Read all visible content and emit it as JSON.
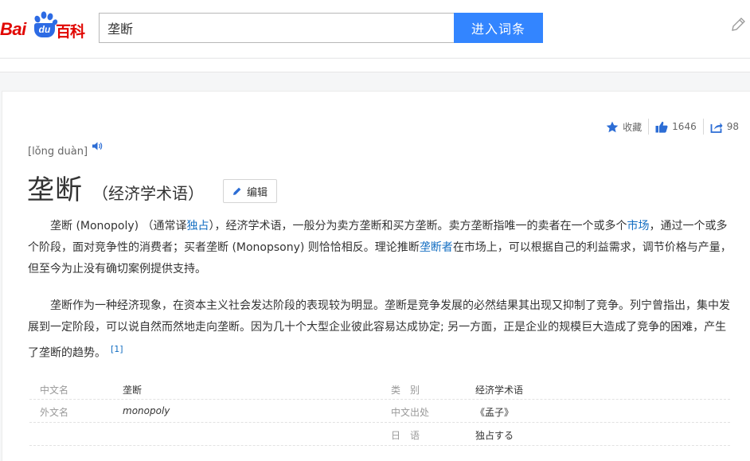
{
  "header": {
    "logo_bai": "Bai",
    "logo_du": "du",
    "logo_baike": "百科",
    "search_value": "垄断",
    "search_button": "进入词条"
  },
  "toolbar": {
    "favorite_label": "收藏",
    "like_count": "1646",
    "share_count": "98"
  },
  "entry": {
    "pinyin": "[lǒng duàn]",
    "title": "垄断",
    "subtitle": "（经济学术语）",
    "edit_label": "编辑"
  },
  "paragraph1": {
    "s1": "垄断 (Monopoly) （通常译",
    "link1": "独占",
    "s2": "），经济学术语，一般分为卖方垄断和买方垄断。卖方垄断指唯一的卖者在一个或多个",
    "link2": "市场",
    "s3": "，通过一个或多个阶段，面对竞争性的消费者；买者垄断 (Monopsony) 则恰恰相反。理论推断",
    "link3": "垄断者",
    "s4": "在市场上，可以根据自己的利益需求，调节价格与产量，但至今为止没有确切案例提供支持。"
  },
  "paragraph2": {
    "text": "垄断作为一种经济现象，在资本主义社会发达阶段的表现较为明显。垄断是竞争发展的必然结果其出现又抑制了竞争。列宁曾指出，集中发展到一定阶段，可以说自然而然地走向垄断。因为几十个大型企业彼此容易达成协定; 另一方面，正是企业的规模巨大造成了竞争的困难，产生了垄断的趋势。",
    "ref": "[1]"
  },
  "basic_info": [
    {
      "k1": "中文名",
      "v1": "垄断",
      "k2": "类　别",
      "v2": "经济学术语"
    },
    {
      "k1": "外文名",
      "v1": "monopoly",
      "k2": "中文出处",
      "v2": "《孟子》"
    },
    {
      "k1": "",
      "v1": "",
      "k2": "日　语",
      "v2": "独占する"
    }
  ],
  "colors": {
    "brand_red": "#e10601",
    "brand_blue": "#2d6be4",
    "search_button": "#3385ff",
    "link": "#136ec2"
  }
}
